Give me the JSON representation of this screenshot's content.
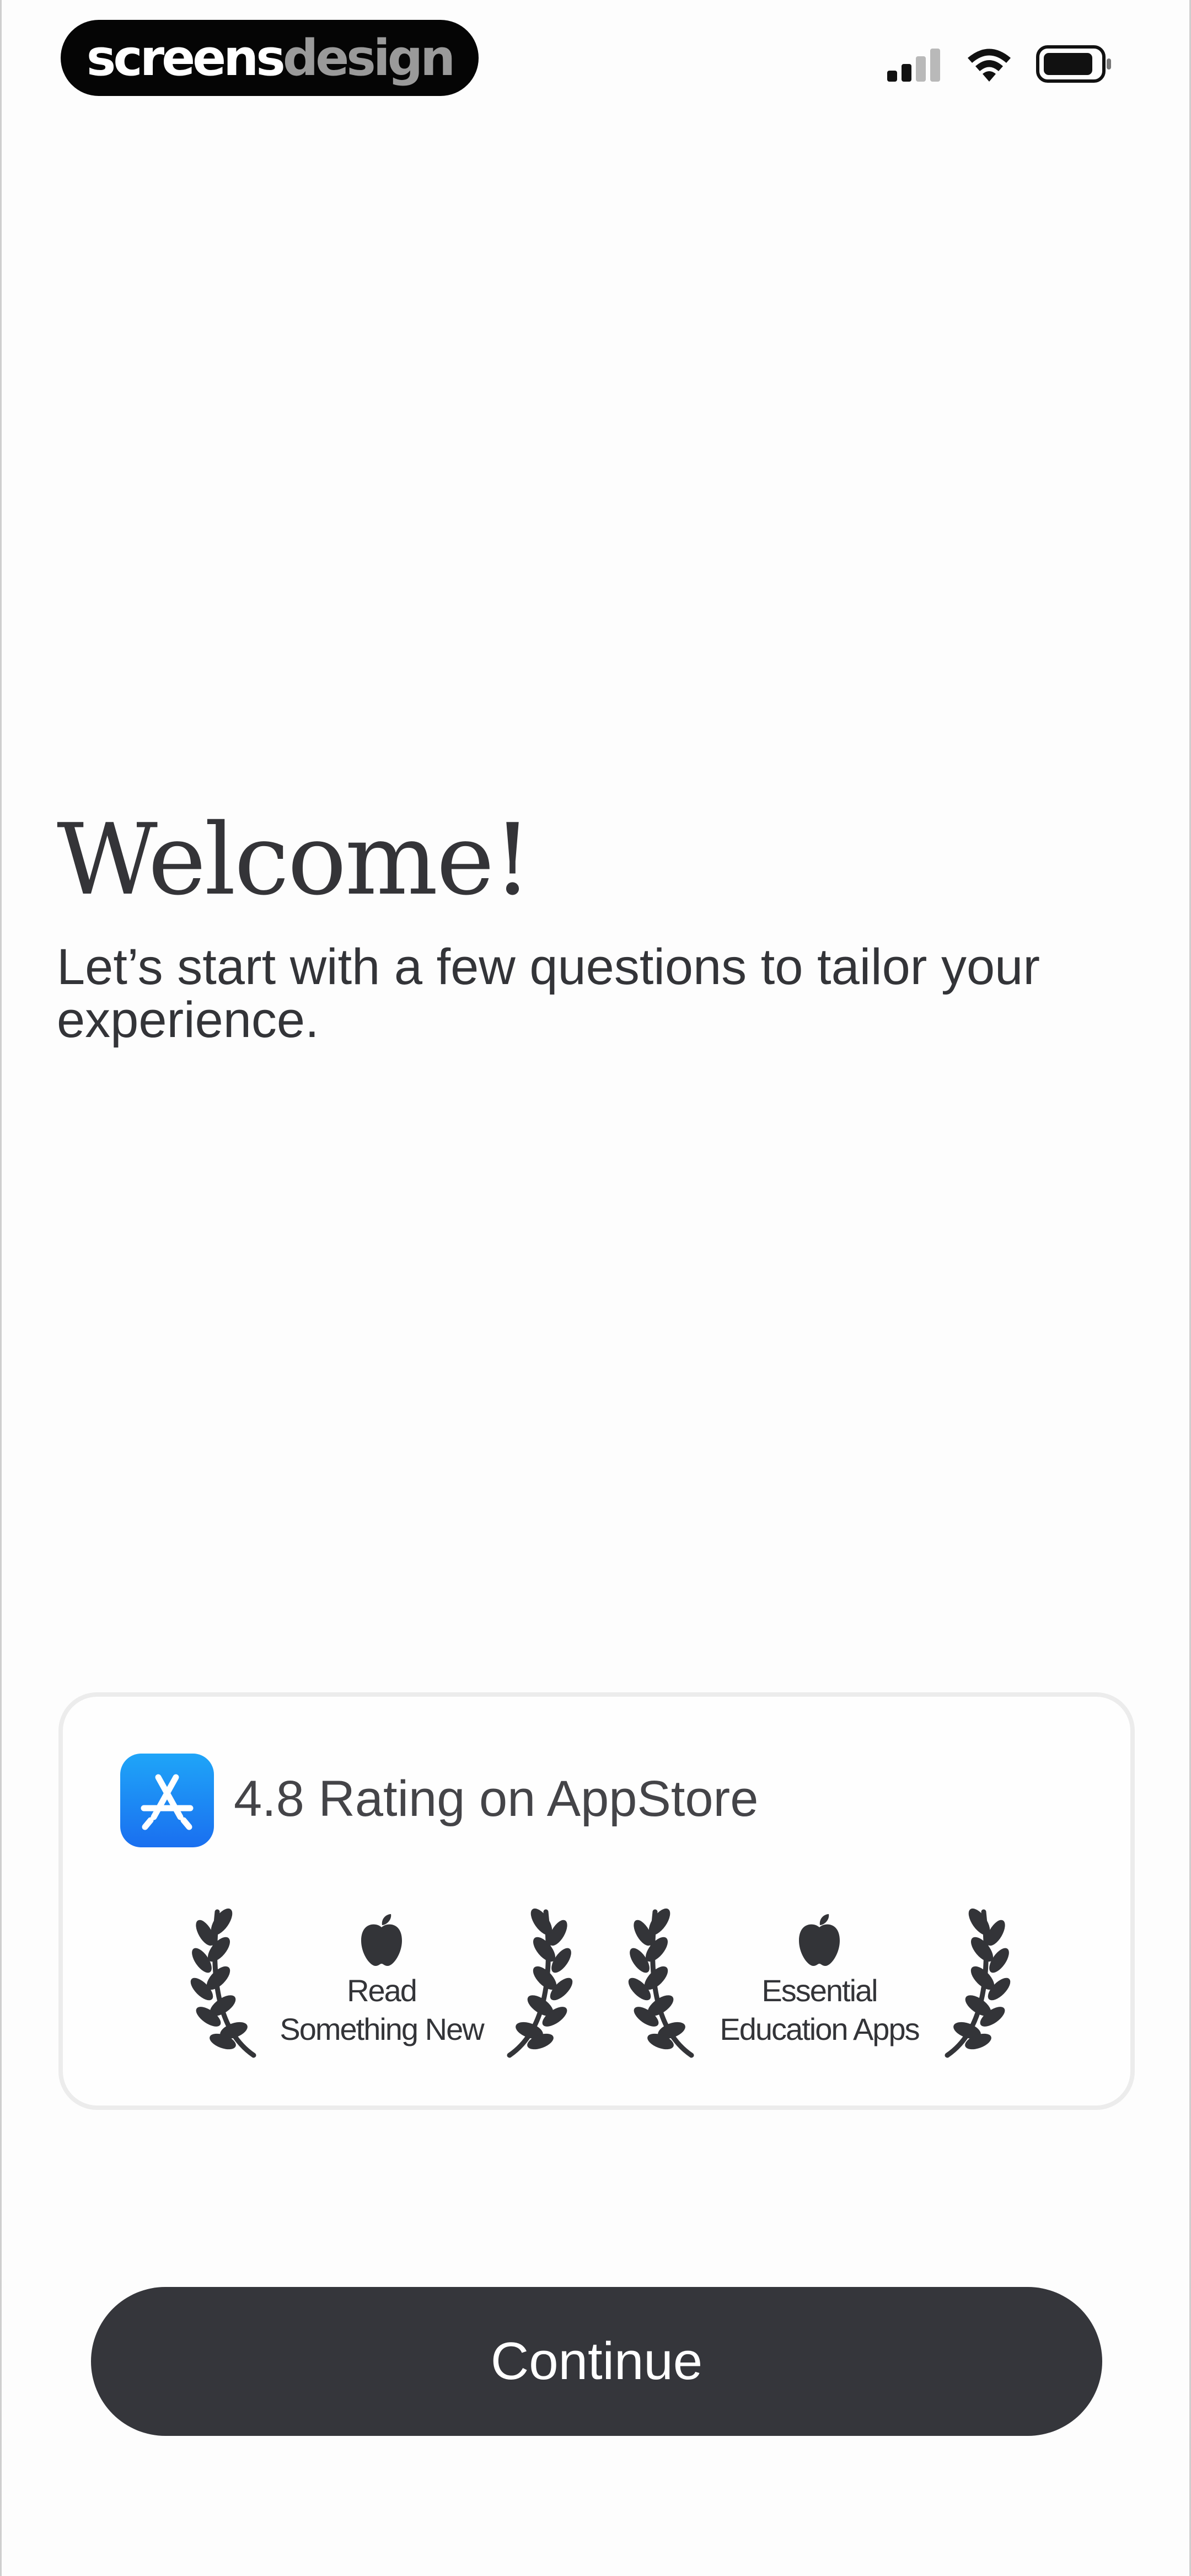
{
  "status_bar": {
    "brand_part1": "screens",
    "brand_part2": "design",
    "signal_icon": "cellular-signal-icon",
    "wifi_icon": "wifi-icon",
    "battery_icon": "battery-icon"
  },
  "welcome": {
    "title": "Welcome!",
    "subtitle": "Let’s start with a few questions to tailor your experience."
  },
  "rating_card": {
    "rating_text": "4.8 Rating on AppStore",
    "awards": [
      {
        "line1": "Read",
        "line2": "Something New"
      },
      {
        "line1": "Essential",
        "line2": "Education Apps"
      }
    ]
  },
  "continue_button": {
    "label": "Continue"
  },
  "colors": {
    "button_bg": "#35363b",
    "text": "#333438",
    "appstore_gradient_top": "#1fa5f8",
    "appstore_gradient_bottom": "#1a6ff0",
    "card_border": "#ececec"
  }
}
